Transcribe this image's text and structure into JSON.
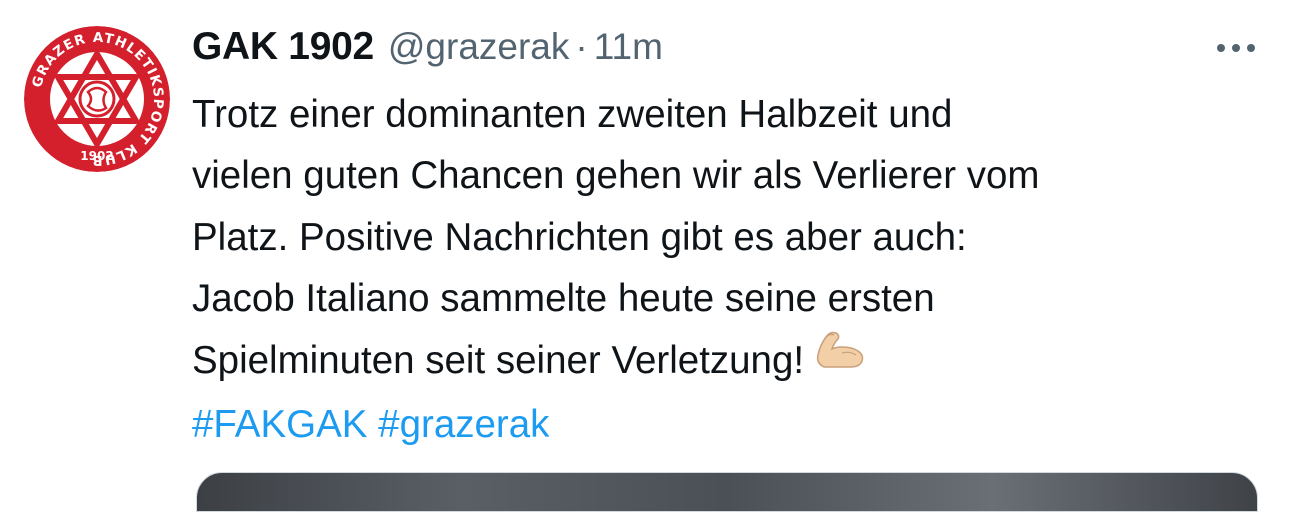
{
  "tweet": {
    "display_name": "GAK 1902",
    "handle": "@grazerak",
    "separator": "·",
    "timestamp": "11m",
    "more_icon": "more-horizontal-icon",
    "lines": [
      "Trotz einer dominanten zweiten Halbzeit und",
      "vielen guten Chancen gehen wir als Verlierer vom",
      "Platz. Positive Nachrichten gibt es aber auch:",
      "Jacob Italiano sammelte heute seine ersten",
      "Spielminuten seit seiner Verletzung!"
    ],
    "emoji": "flexed-biceps-icon",
    "hashtags": [
      "#FAKGAK",
      "#grazerak"
    ]
  },
  "avatar": {
    "ring_text": "GRAZER ATHLETIKSPORT KLUB",
    "year": "1902",
    "icon": "gak-logo-icon"
  },
  "colors": {
    "text": "#0f1419",
    "secondary": "#536471",
    "link": "#1d9bf0",
    "logo_red": "#d4202c"
  }
}
